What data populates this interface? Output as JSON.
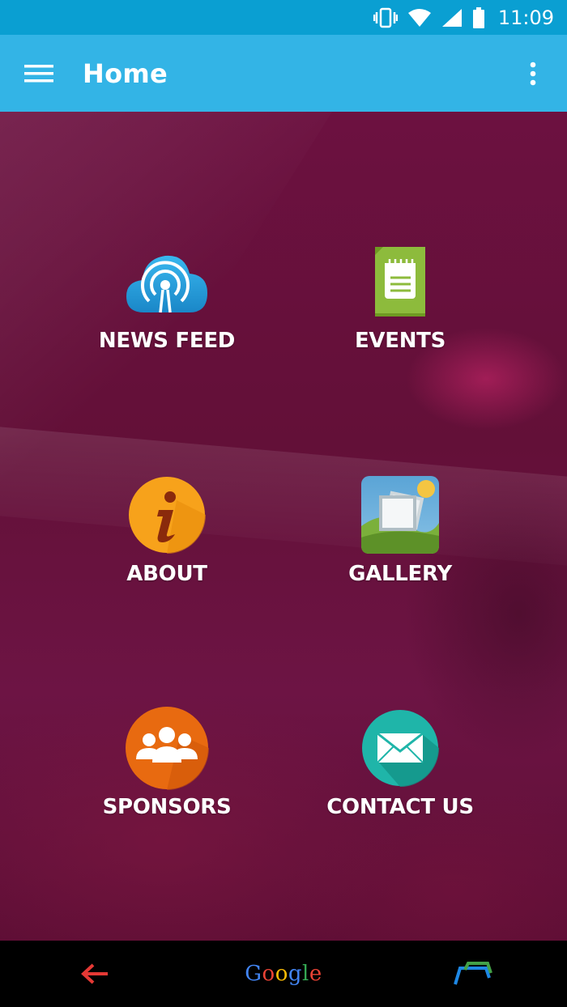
{
  "status_bar": {
    "time": "11:09",
    "icons": [
      "vibrate-icon",
      "wifi-icon",
      "signal-icon",
      "battery-icon"
    ]
  },
  "app_bar": {
    "title": "Home",
    "menu_icon": "hamburger-menu-icon",
    "overflow_icon": "more-vert-icon"
  },
  "tiles": [
    {
      "label": "NEWS FEED",
      "icon": "broadcast-cloud-icon"
    },
    {
      "label": "EVENTS",
      "icon": "notepad-icon"
    },
    {
      "label": "ABOUT",
      "icon": "info-icon"
    },
    {
      "label": "GALLERY",
      "icon": "photos-icon"
    },
    {
      "label": "SPONSORS",
      "icon": "group-icon"
    },
    {
      "label": "CONTACT US",
      "icon": "envelope-icon"
    }
  ],
  "nav_bar": {
    "back_icon": "back-arrow-icon",
    "home_text": "Google",
    "home_letters": [
      "G",
      "o",
      "o",
      "g",
      "l",
      "e"
    ],
    "recents_icon": "recents-icon"
  },
  "colors": {
    "status_bar": "#0a9fd2",
    "app_bar": "#33b4e6",
    "background": "#651039"
  }
}
